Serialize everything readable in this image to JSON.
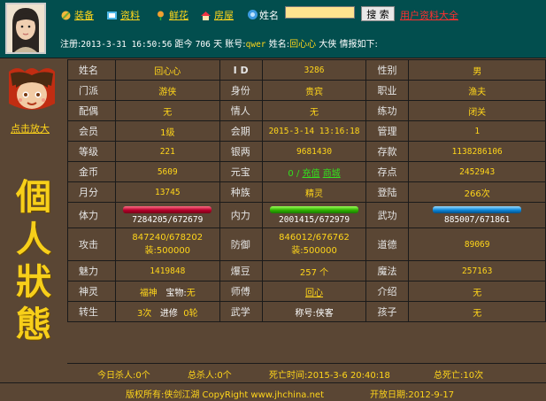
{
  "nav": {
    "items": [
      {
        "label": "装备",
        "icon": "equipment-icon"
      },
      {
        "label": "资料",
        "icon": "profile-icon"
      },
      {
        "label": "鲜花",
        "icon": "flower-icon"
      },
      {
        "label": "房屋",
        "icon": "house-icon"
      }
    ],
    "search_label": "姓名",
    "search_value": "",
    "search_button": "搜 索",
    "all_users_link": "用户资料大全"
  },
  "reg": {
    "prefix": "注册:",
    "date": "2013-3-31 16:50:56",
    "mid1": "距今",
    "days": "706",
    "mid2": "天 账号:",
    "account": "qwer",
    "mid3": "姓名:",
    "name": "回心心",
    "tail": "大侠 情报如下:"
  },
  "left": {
    "zoom_link": "点击放大",
    "title_chars": [
      "個",
      "人",
      "狀",
      "態"
    ]
  },
  "rows": {
    "name": {
      "label": "姓名",
      "value": "回心心"
    },
    "id": {
      "label": "I D",
      "value": "3286"
    },
    "gender": {
      "label": "性别",
      "value": "男"
    },
    "sect": {
      "label": "门派",
      "value": "游侠"
    },
    "identity": {
      "label": "身份",
      "value": "贵宾"
    },
    "job": {
      "label": "职业",
      "value": "渔夫"
    },
    "spouse": {
      "label": "配偶",
      "value": "无"
    },
    "lover": {
      "label": "情人",
      "value": "无"
    },
    "training": {
      "label": "练功",
      "value": "闭关"
    },
    "member": {
      "label": "会员",
      "value": "1级"
    },
    "term": {
      "label": "会期",
      "value": "2015-3-14 13:16:18"
    },
    "admin": {
      "label": "管理",
      "value": "1"
    },
    "level": {
      "label": "等级",
      "value": "221"
    },
    "silver": {
      "label": "银两",
      "value": "9681430"
    },
    "deposit": {
      "label": "存款",
      "value": "1138286106"
    },
    "gold": {
      "label": "金币",
      "value": "5609"
    },
    "yuanbao": {
      "label": "元宝",
      "value": "0",
      "sep": "/",
      "recharge": "充值",
      "shop": "商城"
    },
    "points": {
      "label": "存点",
      "value": "2452943"
    },
    "monthly": {
      "label": "月分",
      "value": "13745"
    },
    "race": {
      "label": "种族",
      "value": "精灵"
    },
    "login": {
      "label": "登陆",
      "value": "266次"
    },
    "stamina": {
      "label": "体力",
      "value": "7284205/672679",
      "fill": 1.0
    },
    "inner": {
      "label": "内力",
      "value": "2001415/672979",
      "fill": 1.0
    },
    "martial": {
      "label": "武功",
      "value": "885007/671861",
      "fill": 1.0
    },
    "attack": {
      "label": "攻击",
      "value": "847240/678202",
      "equip": "装:500000"
    },
    "defense": {
      "label": "防御",
      "value": "846012/676762",
      "equip": "装:500000"
    },
    "morality": {
      "label": "道德",
      "value": "89069"
    },
    "charm": {
      "label": "魅力",
      "value": "1419848"
    },
    "beans": {
      "label": "爆豆",
      "value": "257 个"
    },
    "magic": {
      "label": "魔法",
      "value": "257163"
    },
    "spirit": {
      "label": "神灵",
      "value": "福神"
    },
    "pet": {
      "label": "宝物:",
      "value": "无"
    },
    "master": {
      "label": "师傅",
      "value": "回心"
    },
    "introducer": {
      "label": "介绍",
      "value": "无"
    },
    "rebirth": {
      "label": "转生",
      "value": "3次"
    },
    "advance": {
      "label": "进修",
      "value": "0轮"
    },
    "wuxue": {
      "label": "武学",
      "value": ""
    },
    "title": {
      "label": "称号:侠客",
      "value": ""
    },
    "children": {
      "label": "孩子",
      "value": "无"
    }
  },
  "bottom": {
    "today_kills": "今日杀人:0个",
    "total_kills": "总杀人:0个",
    "death_time": "死亡时间:2015-3-6 20:40:18",
    "total_deaths": "总死亡:10次"
  },
  "footer": {
    "copyright": "版权所有:侠剑江湖 CopyRight www.jhchina.net",
    "open_date": "开放日期:2012-9-17"
  },
  "colors": {
    "accent": "#ffd51a",
    "link_red": "#ff2f2f",
    "top_bg": "#024e4e",
    "panel_bg": "#5a4634"
  }
}
